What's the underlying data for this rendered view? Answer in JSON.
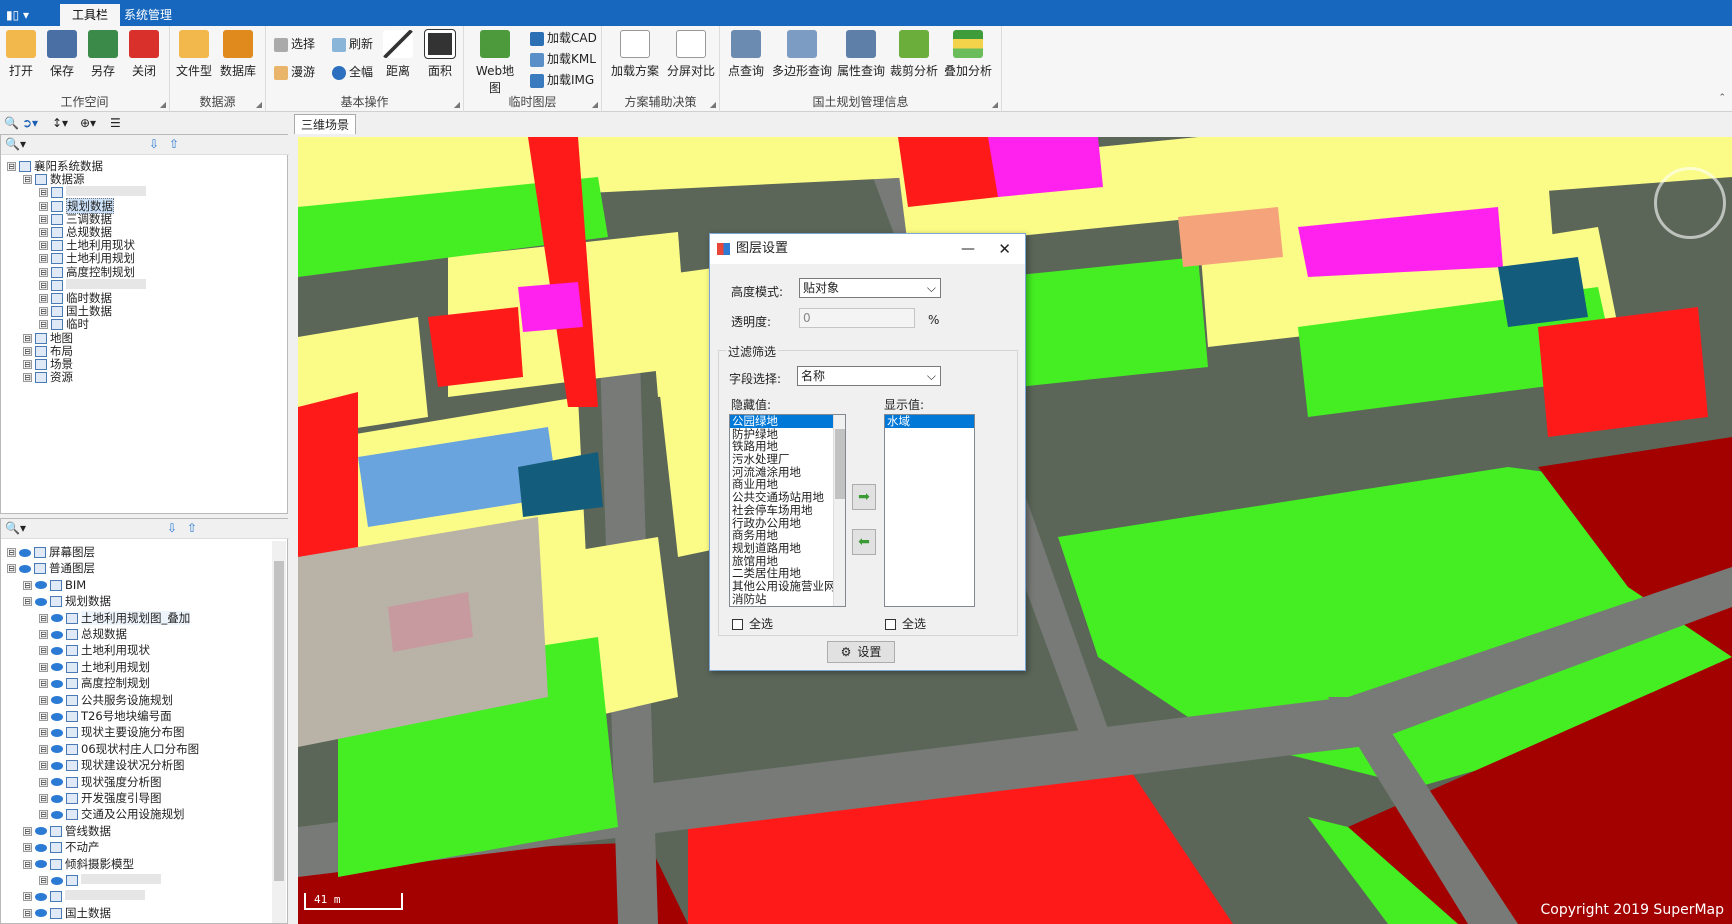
{
  "titlebar": {
    "app_menu": "▮▯ ▾",
    "tabs": [
      "工具栏",
      "系统管理"
    ]
  },
  "ribbon": {
    "workspace": {
      "label": "工作空间",
      "buttons": [
        "打开",
        "保存",
        "另存",
        "关闭"
      ]
    },
    "datasource": {
      "label": "数据源",
      "buttons": [
        "文件型",
        "数据库"
      ]
    },
    "basic": {
      "label": "基本操作",
      "small": [
        "选择",
        "漫游",
        "刷新",
        "全幅"
      ],
      "big": [
        "距离",
        "面积"
      ]
    },
    "temp": {
      "label": "临时图层",
      "big": "Web地图",
      "small": [
        "加载CAD",
        "加载KML",
        "加载IMG"
      ]
    },
    "plan": {
      "label": "方案辅助决策",
      "buttons": [
        "加载方案",
        "分屏对比"
      ]
    },
    "land": {
      "label": "国土规划管理信息",
      "buttons": [
        "点查询",
        "多边形查询",
        "属性查询",
        "裁剪分析",
        "叠加分析"
      ]
    }
  },
  "tree1": [
    {
      "t": "襄阳系统数据",
      "lv": 0
    },
    {
      "t": "数据源",
      "lv": 1
    },
    {
      "t": "",
      "lv": 2
    },
    {
      "t": "规划数据",
      "lv": 2,
      "sel": true
    },
    {
      "t": "三调数据",
      "lv": 2
    },
    {
      "t": "总规数据",
      "lv": 2
    },
    {
      "t": "土地利用现状",
      "lv": 2
    },
    {
      "t": "土地利用规划",
      "lv": 2
    },
    {
      "t": "高度控制规划",
      "lv": 2
    },
    {
      "t": "",
      "lv": 2
    },
    {
      "t": "临时数据",
      "lv": 2
    },
    {
      "t": "国土数据",
      "lv": 2
    },
    {
      "t": "临时",
      "lv": 2
    },
    {
      "t": "地图",
      "lv": 1
    },
    {
      "t": "布局",
      "lv": 1
    },
    {
      "t": "场景",
      "lv": 1
    },
    {
      "t": "资源",
      "lv": 1
    }
  ],
  "tree2": [
    {
      "t": "屏幕图层",
      "lv": 0
    },
    {
      "t": "普通图层",
      "lv": 0
    },
    {
      "t": "BIM",
      "lv": 1
    },
    {
      "t": "规划数据",
      "lv": 1
    },
    {
      "t": "土地利用规划图_叠加",
      "lv": 2,
      "hl": true
    },
    {
      "t": "总规数据",
      "lv": 2
    },
    {
      "t": "土地利用现状",
      "lv": 2
    },
    {
      "t": "土地利用规划",
      "lv": 2
    },
    {
      "t": "高度控制规划",
      "lv": 2
    },
    {
      "t": "公共服务设施规划",
      "lv": 2
    },
    {
      "t": "T26号地块编号面",
      "lv": 2
    },
    {
      "t": "现状主要设施分布图",
      "lv": 2
    },
    {
      "t": "06现状村庄人口分布图",
      "lv": 2
    },
    {
      "t": "现状建设状况分析图",
      "lv": 2
    },
    {
      "t": "现状强度分析图",
      "lv": 2
    },
    {
      "t": "开发强度引导图",
      "lv": 2
    },
    {
      "t": "交通及公用设施规划",
      "lv": 2
    },
    {
      "t": "管线数据",
      "lv": 1
    },
    {
      "t": "不动产",
      "lv": 1
    },
    {
      "t": "倾斜摄影模型",
      "lv": 1
    },
    {
      "t": "",
      "lv": 2
    },
    {
      "t": "",
      "lv": 1
    },
    {
      "t": "国土数据",
      "lv": 1
    }
  ],
  "viewport": {
    "tab": "三维场景",
    "scale": "41 m",
    "copyright": "Copyright 2019 SuperMap"
  },
  "dialog": {
    "title": "图层设置",
    "height_label": "高度模式:",
    "height_value": "贴对象",
    "opacity_label": "透明度:",
    "opacity_value": "0",
    "opacity_unit": "%",
    "filter_group": "过滤筛选",
    "field_label": "字段选择:",
    "field_value": "名称",
    "hidden_label": "隐藏值:",
    "shown_label": "显示值:",
    "hidden_values": [
      "公园绿地",
      "防护绿地",
      "铁路用地",
      "污水处理厂",
      "河流滩涂用地",
      "商业用地",
      "公共交通场站用地",
      "社会停车场用地",
      "行政办公用地",
      "商务用地",
      "规划道路用地",
      "旅馆用地",
      "二类居住用地",
      "其他公用设施营业网",
      "消防站"
    ],
    "shown_values": [
      "水域"
    ],
    "select_all": "全选",
    "select_all2": "全选",
    "ok": "设置"
  },
  "colors": {
    "ribbon_blue": "#1667bd",
    "residential": "#fbfc87",
    "commercial": "#ff1a1a",
    "green": "#44ee22",
    "darkred": "#a30000",
    "magenta": "#ff22ee"
  }
}
